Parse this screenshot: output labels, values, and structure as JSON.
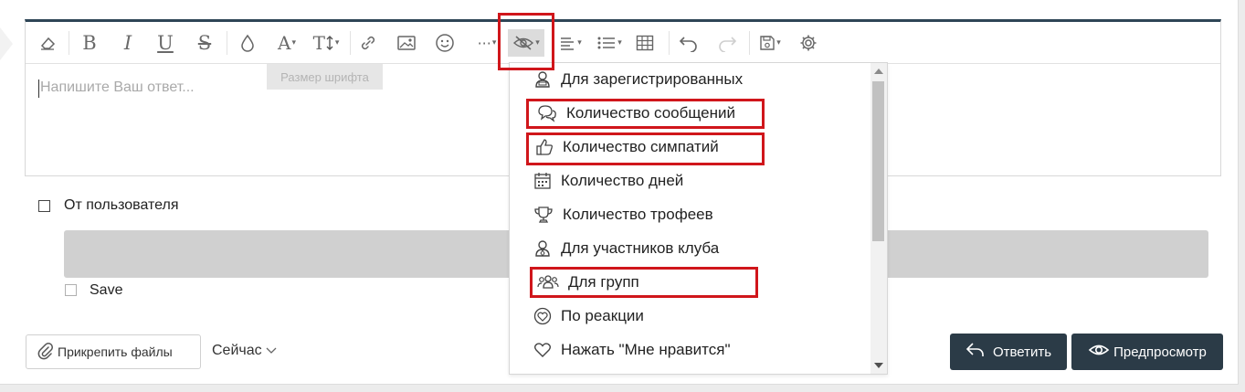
{
  "toolbar": {
    "tooltip": "Размер шрифта",
    "text_caret": "▾"
  },
  "editor": {
    "placeholder": "Напишите Ваш ответ..."
  },
  "options": {
    "from_user_label": "От пользователя",
    "save_label": "Save"
  },
  "hide_menu": {
    "items": [
      {
        "label": "Для зарегистрированных",
        "icon": "user-check-icon",
        "highlighted": false
      },
      {
        "label": "Количество сообщений",
        "icon": "comments-icon",
        "highlighted": true
      },
      {
        "label": "Количество симпатий",
        "icon": "thumbs-up-icon",
        "highlighted": true
      },
      {
        "label": "Количество дней",
        "icon": "calendar-icon",
        "highlighted": false
      },
      {
        "label": "Количество трофеев",
        "icon": "trophy-icon",
        "highlighted": false
      },
      {
        "label": "Для участников клуба",
        "icon": "club-member-icon",
        "highlighted": false
      },
      {
        "label": "Для групп",
        "icon": "users-icon",
        "highlighted": true
      },
      {
        "label": "По реакции",
        "icon": "reaction-icon",
        "highlighted": false
      },
      {
        "label": "Нажать \"Мне нравится\"",
        "icon": "heart-icon",
        "highlighted": false
      }
    ]
  },
  "footer": {
    "attach_label": "Прикрепить файлы",
    "schedule_label": "Сейчас",
    "reply_label": "Ответить",
    "preview_label": "Предпросмотр"
  },
  "colors": {
    "accent_dark": "#2b3b47",
    "highlight_red": "#d0161b"
  }
}
